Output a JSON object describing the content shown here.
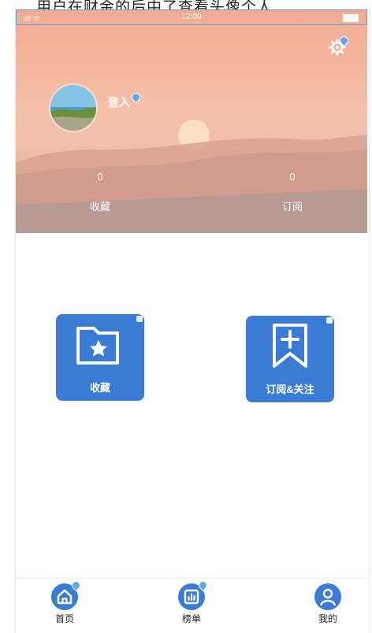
{
  "caption": "用户在财金的后中了查看头像个人",
  "status_bar": {
    "signal": "ııll ᯤ",
    "time": "12:00"
  },
  "profile": {
    "login_label": "登入"
  },
  "stats": [
    {
      "value": "0",
      "label": "收藏"
    },
    {
      "value": "0",
      "label": "订阅"
    }
  ],
  "features": [
    {
      "label": "收藏",
      "icon": "folder-star-icon"
    },
    {
      "label": "订阅&关注",
      "icon": "bookmark-plus-icon"
    }
  ],
  "nav": [
    {
      "label": "首页",
      "icon": "home-icon"
    },
    {
      "label": "榜单",
      "icon": "chart-icon"
    },
    {
      "label": "我的",
      "icon": "user-icon"
    }
  ],
  "colors": {
    "accent": "#3a7bd5",
    "hero_top": "#f2ab91",
    "hero_bottom": "#d0a39a"
  }
}
